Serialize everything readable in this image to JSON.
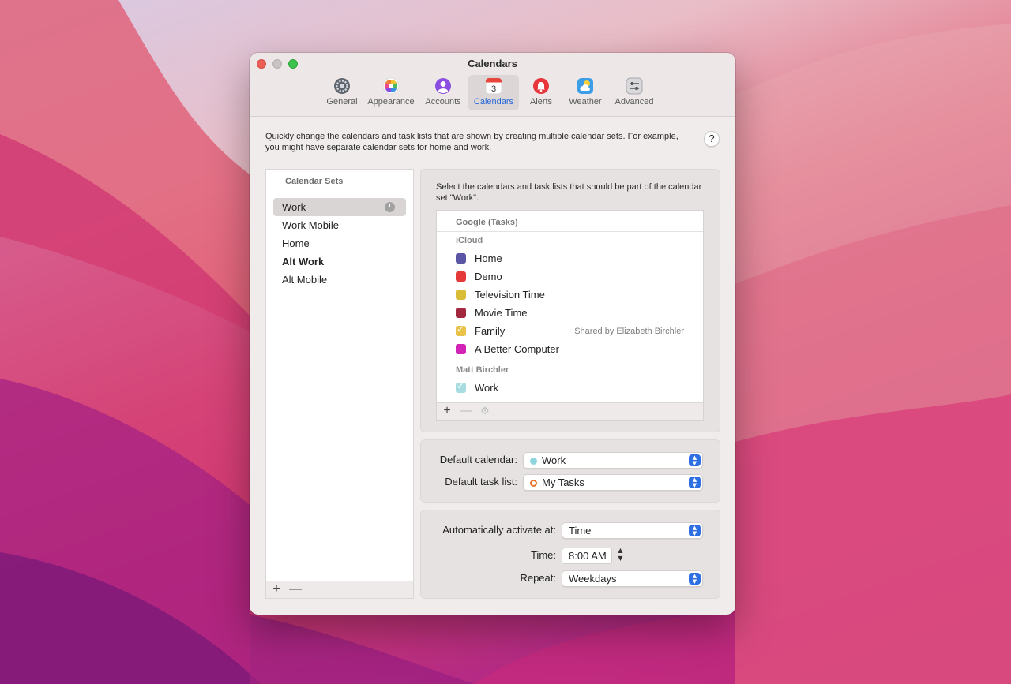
{
  "window": {
    "title": "Calendars"
  },
  "toolbar": {
    "tabs": [
      {
        "label": "General",
        "icon": "gear-icon"
      },
      {
        "label": "Appearance",
        "icon": "color-wheel-icon"
      },
      {
        "label": "Accounts",
        "icon": "person-icon"
      },
      {
        "label": "Calendars",
        "icon": "calendar-icon",
        "active": true,
        "badge": "3"
      },
      {
        "label": "Alerts",
        "icon": "bell-icon"
      },
      {
        "label": "Weather",
        "icon": "weather-icon"
      },
      {
        "label": "Advanced",
        "icon": "sliders-icon"
      }
    ]
  },
  "description": "Quickly change the calendars and task lists that are shown by creating multiple calendar sets. For example, you might have separate calendar sets for home and work.",
  "help_label": "?",
  "calendar_sets": {
    "header": "Calendar Sets",
    "items": [
      {
        "label": "Work",
        "selected": true,
        "scheduled": true
      },
      {
        "label": "Work Mobile"
      },
      {
        "label": "Home"
      },
      {
        "label": "Alt Work",
        "bold": true
      },
      {
        "label": "Alt Mobile"
      }
    ],
    "add_label": "+",
    "remove_label": "—"
  },
  "selection": {
    "intro": "Select the calendars and task lists that should be part of the calendar set \"Work\".",
    "google_header": "Google (Tasks)",
    "groups": [
      {
        "name": "iCloud",
        "calendars": [
          {
            "name": "Home",
            "color": "#5b55a6",
            "checked": false
          },
          {
            "name": "Demo",
            "color": "#e5393a",
            "checked": false
          },
          {
            "name": "Television Time",
            "color": "#d9bd38",
            "checked": false
          },
          {
            "name": "Movie Time",
            "color": "#a1283f",
            "checked": false
          },
          {
            "name": "Family",
            "color": "#e9c24a",
            "checked": true,
            "shared": "Shared by Elizabeth Birchler"
          },
          {
            "name": "A Better Computer",
            "color": "#d322b6",
            "checked": false
          }
        ]
      },
      {
        "name": "Matt Birchler",
        "calendars": [
          {
            "name": "Work",
            "color": "#a7dce0",
            "checked": true
          }
        ]
      }
    ],
    "add_label": "+",
    "remove_label": "—"
  },
  "defaults": {
    "calendar_label": "Default calendar:",
    "calendar_value": "Work",
    "calendar_color": "#8fd6dc",
    "task_label": "Default task list:",
    "task_value": "My Tasks",
    "task_color": "#e9732b"
  },
  "activation": {
    "label": "Automatically activate at:",
    "value": "Time",
    "time_label": "Time:",
    "time_value": "8:00 AM",
    "repeat_label": "Repeat:",
    "repeat_value": "Weekdays"
  }
}
